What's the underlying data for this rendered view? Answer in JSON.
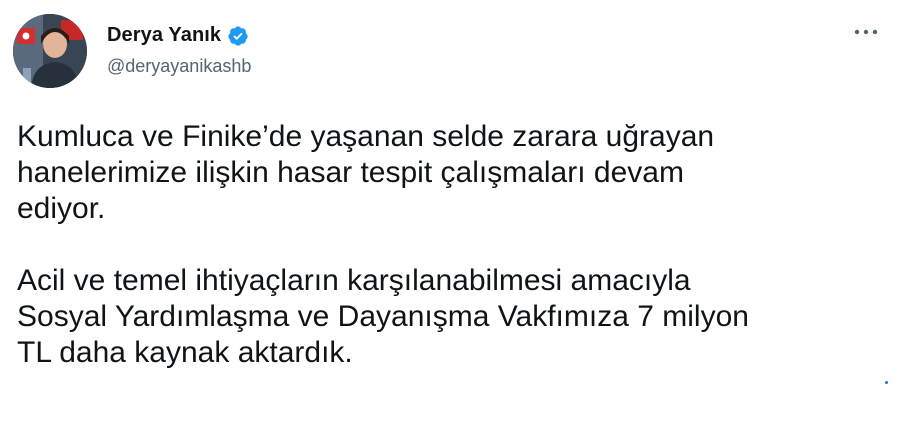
{
  "tweet": {
    "author": {
      "display_name": "Derya Yanık",
      "handle": "@deryayanikashb",
      "verified": true,
      "avatar_icon": "profile-photo"
    },
    "more_icon": "more-options-icon",
    "text": {
      "paragraph_1": "Kumluca ve Finike’de yaşanan selde zarara uğrayan\nhanelerimize ilişkin hasar tespit çalışmaları devam\nediyor.",
      "paragraph_2": "Acil ve temel ihtiyaçların karşılanabilmesi amacıyla\nSosyal Yardımlaşma ve Dayanışma Vakfımıza 7 milyon\nTL daha kaynak aktardık."
    }
  },
  "colors": {
    "text_primary": "#0f1419",
    "text_secondary": "#536471",
    "verified_blue": "#1d9bf0"
  }
}
